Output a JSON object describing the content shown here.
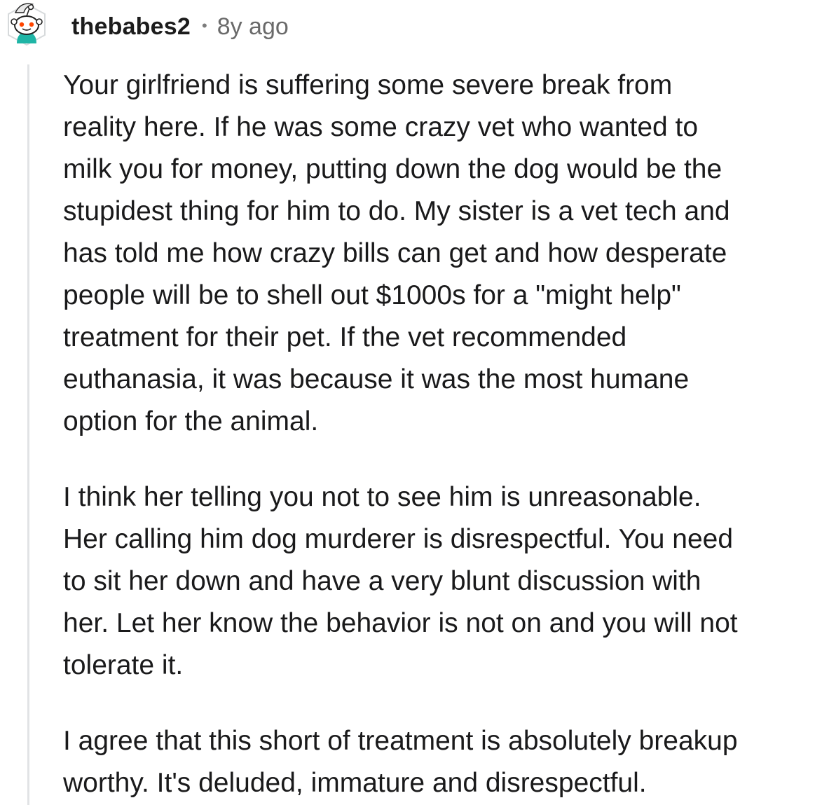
{
  "comment": {
    "username": "thebabes2",
    "separator": "•",
    "age": "8y ago",
    "avatar_icon": "reddit-snoo-avatar-icon",
    "colors": {
      "text": "#1a1a1b",
      "meta": "#6a6a6a",
      "thread_line": "#e1e3e5",
      "avatar_accent": "#1fb5a6"
    },
    "paragraphs": [
      {
        "lines": [
          "Your girlfriend is suffering some severe break from",
          "reality here. If he was some crazy vet who wanted to",
          "milk you for money, putting down the dog would be the",
          "stupidest thing for him to do. My sister is a vet tech and",
          "has told me how crazy bills can get and how desperate",
          "people will be to shell out $1000s for a \"might help\"",
          "treatment for their pet. If the vet recommended",
          "euthanasia, it was because it was the most humane",
          "option for the animal."
        ]
      },
      {
        "lines": [
          "I think her telling you not to see him is unreasonable.",
          "Her calling him dog murderer is disrespectful. You need",
          "to sit her down and have a very blunt discussion with",
          "her. Let her know the behavior is not on and you will not",
          "tolerate it."
        ]
      },
      {
        "lines": [
          "I agree that this short of treatment is absolutely breakup",
          "worthy. It's deluded, immature and disrespectful."
        ]
      }
    ]
  }
}
